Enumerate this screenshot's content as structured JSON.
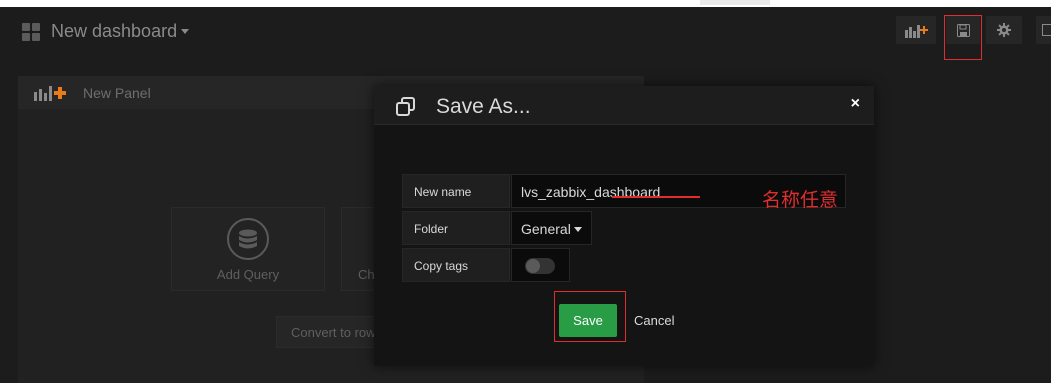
{
  "navbar": {
    "dashboard_title": "New dashboard",
    "buttons": [
      "add-panel",
      "save-dashboard",
      "settings",
      "cycle-view"
    ]
  },
  "panel": {
    "title": "New Panel",
    "actions": {
      "add_query": "Add Query",
      "choose_visualization": "Ch",
      "convert_to_row": "Convert to row"
    }
  },
  "modal": {
    "title": "Save As...",
    "close": "×",
    "fields": {
      "name_label": "New name",
      "name_value": "lvs_zabbix_dashboard",
      "folder_label": "Folder",
      "folder_value": "General",
      "copy_tags_label": "Copy tags",
      "copy_tags_enabled": false
    },
    "save_label": "Save",
    "cancel_label": "Cancel"
  },
  "annotation": {
    "text": "名称任意",
    "color": "#e02d2d"
  },
  "colors": {
    "background": "#1c1c1c",
    "modal": "#141414",
    "save_button": "#299c46"
  }
}
